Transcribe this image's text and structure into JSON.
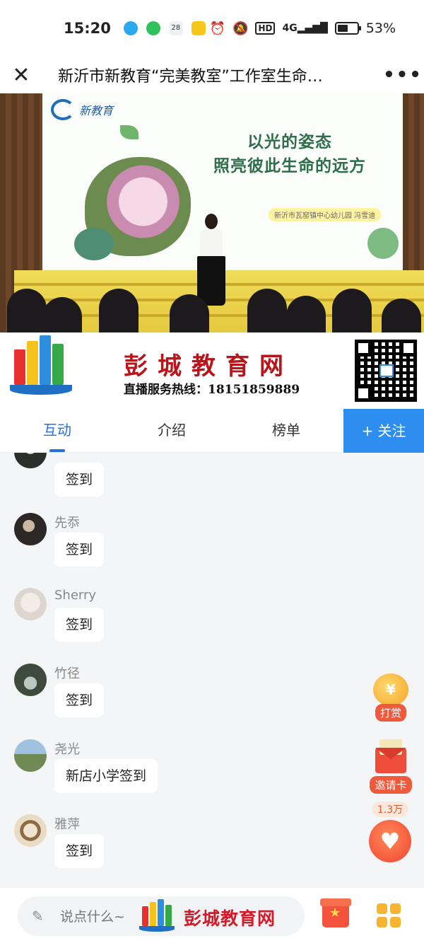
{
  "status_bar": {
    "time": "15:20",
    "calendar_day": "28",
    "hd": "HD",
    "network": "4G",
    "battery_percent": "53%",
    "battery_level": 0.53
  },
  "nav": {
    "title": "新沂市新教育“完美教室”工作室生命…",
    "close_icon": "close-icon",
    "more_icon": "more-icon"
  },
  "video": {
    "screen_title_line1": "以光的姿态",
    "screen_title_line2": "照亮彼此生命的远方",
    "screen_logo_text": "新教育",
    "screen_subtitle": "新沂市瓦窑镇中心幼儿园 冯雪迪"
  },
  "banner": {
    "title": "彭城教育网",
    "hotline": "直播服务热线：18151859889"
  },
  "tabs": {
    "items": [
      {
        "label": "互动"
      },
      {
        "label": "介绍"
      },
      {
        "label": "榜单"
      }
    ],
    "follow_label": "+ 关注"
  },
  "chat": {
    "messages": [
      {
        "name": "",
        "text": "签到"
      },
      {
        "name": "先忝",
        "text": "签到"
      },
      {
        "name": "Sherry",
        "text": "签到"
      },
      {
        "name": "竹径",
        "text": "签到"
      },
      {
        "name": "尧光",
        "text": "新店小学签到"
      },
      {
        "name": "雅萍",
        "text": "签到"
      }
    ]
  },
  "floating": {
    "reward_label": "打赏",
    "invite_label": "邀请卡",
    "like_count": "1.3万"
  },
  "bottom_bar": {
    "input_placeholder": "说点什么~",
    "watermark_text": "彭城教育网"
  },
  "colors": {
    "accent": "#2571d9",
    "follow_bg": "#2d8ef0",
    "banner_red": "#b8141a"
  }
}
